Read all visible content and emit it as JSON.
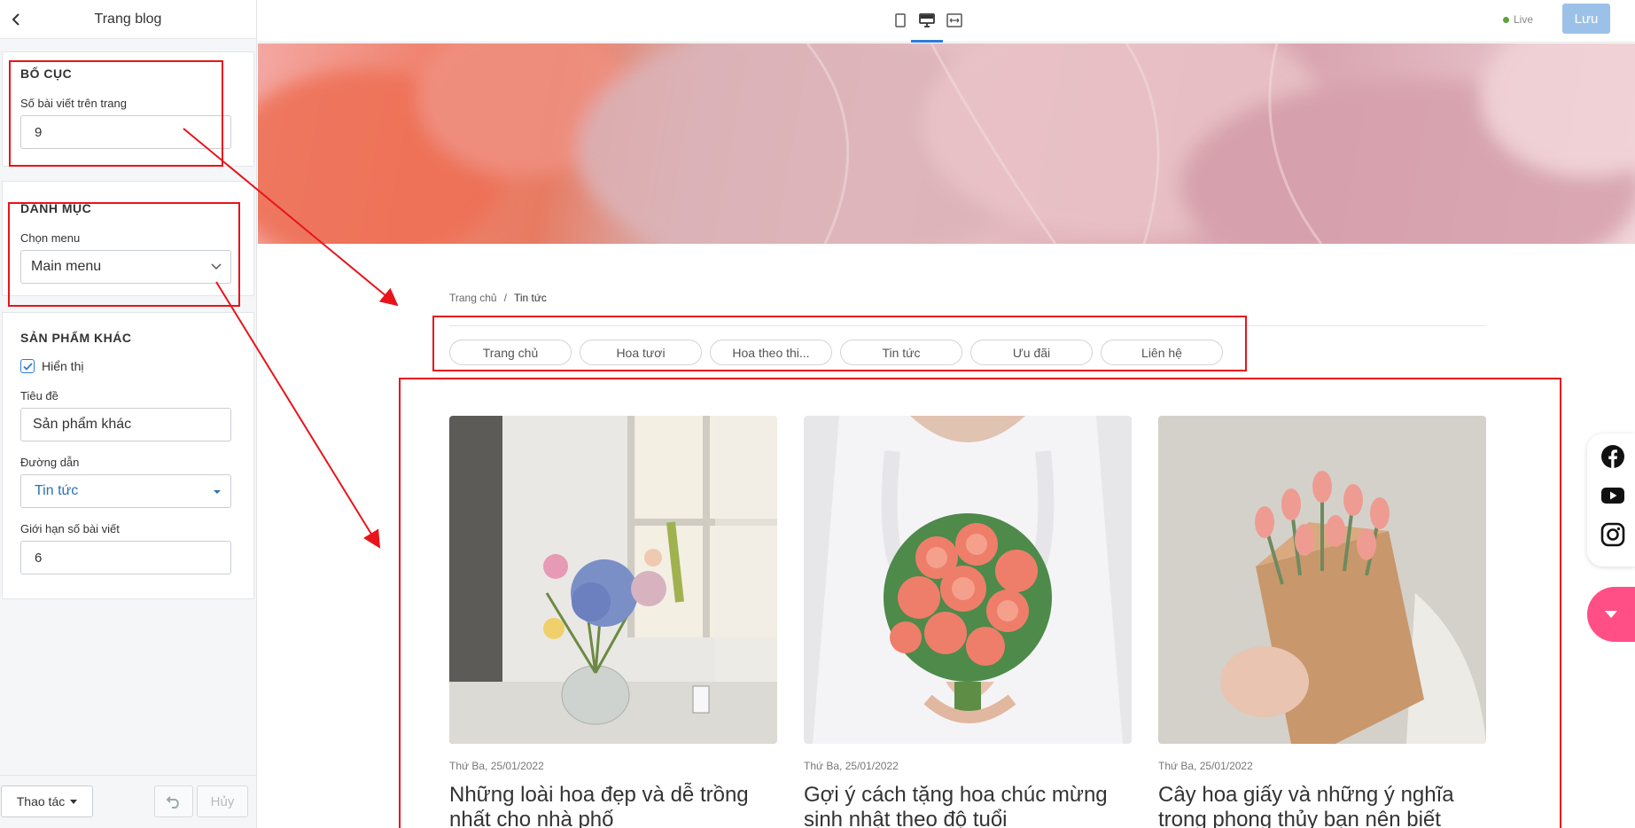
{
  "sidebar": {
    "title": "Trang blog",
    "layout": {
      "heading": "BỐ CỤC",
      "posts_per_page_label": "Số bài viết trên trang",
      "posts_per_page_value": "9"
    },
    "category": {
      "heading": "DANH MỤC",
      "menu_label": "Chọn menu",
      "menu_value": "Main menu"
    },
    "other_products": {
      "heading": "SẢN PHẨM KHÁC",
      "show_label": "Hiển thị",
      "show_checked": true,
      "title_label": "Tiêu đề",
      "title_value": "Sản phẩm khác",
      "path_label": "Đường dẫn",
      "path_value": "Tin tức",
      "limit_label": "Giới hạn số bài viết",
      "limit_value": "6"
    },
    "footer": {
      "action_label": "Thao tác",
      "cancel_label": "Hủy"
    }
  },
  "topbar": {
    "live_label": "Live",
    "save_label": "Lưu"
  },
  "preview": {
    "breadcrumb": {
      "home": "Trang chủ",
      "separator": "/",
      "current": "Tin tức"
    },
    "tabs": [
      "Trang chủ",
      "Hoa tươi",
      "Hoa theo thi...",
      "Tin tức",
      "Ưu đãi",
      "Liên hệ"
    ],
    "posts": [
      {
        "date": "Thứ Ba, 25/01/2022",
        "title": "Những loài hoa đẹp và dễ trồng nhất cho nhà phố"
      },
      {
        "date": "Thứ Ba, 25/01/2022",
        "title": "Gợi ý cách tặng hoa chúc mừng sinh nhật theo độ tuổi"
      },
      {
        "date": "Thứ Ba, 25/01/2022",
        "title": "Cây hoa giấy và những ý nghĩa trong phong thủy bạn nên biết"
      }
    ]
  },
  "colors": {
    "accent": "#2f7bd9",
    "save_button": "#9cc1e8",
    "fab": "#ff4f86",
    "annotation": "#e8141b"
  },
  "icons": [
    "back-arrow-icon",
    "tablet-icon",
    "desktop-icon",
    "fullwidth-icon",
    "check-icon",
    "chevron-down-icon",
    "caret-down-icon",
    "undo-icon",
    "facebook-icon",
    "youtube-icon",
    "instagram-icon"
  ]
}
